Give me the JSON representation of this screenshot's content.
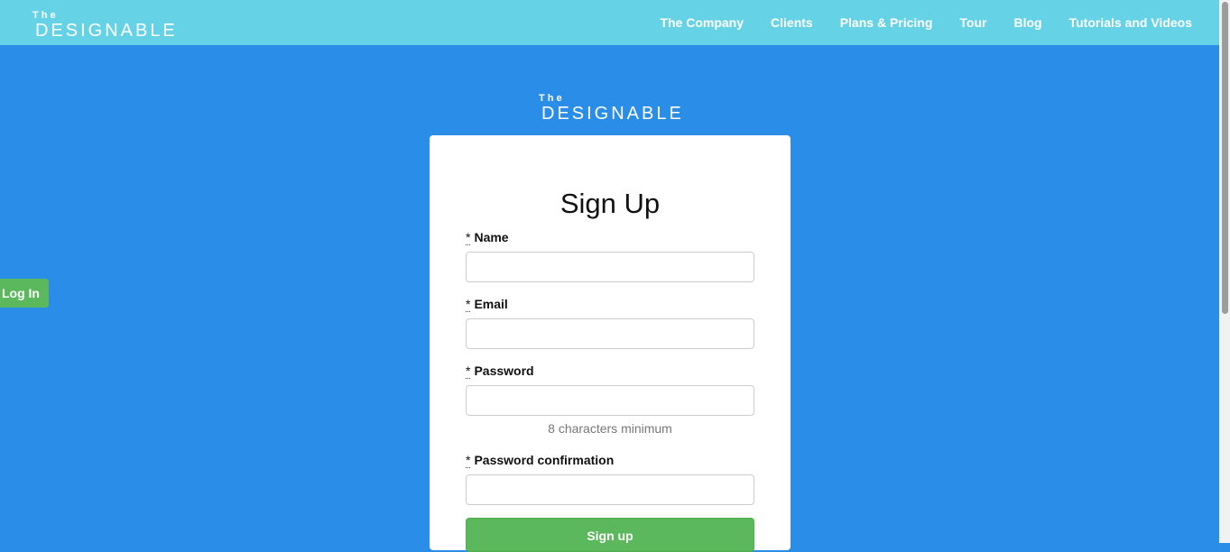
{
  "header": {
    "logo": {
      "the": "The",
      "word": "DESIGNABLE"
    },
    "nav": [
      "The Company",
      "Clients",
      "Plans & Pricing",
      "Tour",
      "Blog",
      "Tutorials and Videos"
    ]
  },
  "login_tab": "Log In",
  "logo_main": {
    "the": "The",
    "word": "DESIGNABLE"
  },
  "form": {
    "title": "Sign Up",
    "required_mark": "*",
    "fields": [
      {
        "label": "Name",
        "value": ""
      },
      {
        "label": "Email",
        "value": ""
      },
      {
        "label": "Password",
        "value": ""
      },
      {
        "label": "Password confirmation",
        "value": ""
      }
    ],
    "password_hint": "8 characters minimum",
    "submit_label": "Sign up"
  },
  "colors": {
    "page_background": "#2a8de8",
    "navbar": "#66d2e6",
    "success_green": "#5cb85c"
  }
}
